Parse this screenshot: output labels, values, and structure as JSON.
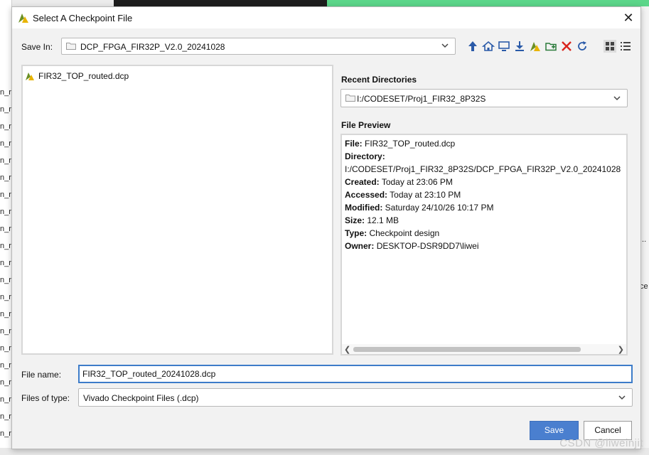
{
  "dialog": {
    "title": "Select A Checkpoint File",
    "close_glyph": "✕"
  },
  "save_in": {
    "label": "Save In:",
    "value": "DCP_FPGA_FIR32P_V2.0_20241028"
  },
  "toolbar": {
    "icons": [
      "up-one-level-icon",
      "home-icon",
      "desktop-icon",
      "download-icon",
      "vivado-project-icon",
      "new-folder-icon",
      "delete-icon",
      "refresh-icon",
      "details-view-icon",
      "list-view-icon"
    ]
  },
  "files": [
    {
      "name": "FIR32_TOP_routed.dcp"
    }
  ],
  "recent": {
    "title": "Recent Directories",
    "value": "I:/CODESET/Proj1_FIR32_8P32S"
  },
  "preview": {
    "title": "File Preview",
    "file_label": "File:",
    "file_value": "FIR32_TOP_routed.dcp",
    "directory_label": "Directory:",
    "directory_value": "I:/CODESET/Proj1_FIR32_8P32S/DCP_FPGA_FIR32P_V2.0_20241028",
    "created_label": "Created:",
    "created_value": "Today at 23:06 PM",
    "accessed_label": "Accessed:",
    "accessed_value": "Today at 23:10 PM",
    "modified_label": "Modified:",
    "modified_value": "Saturday 24/10/26 10:17 PM",
    "size_label": "Size:",
    "size_value": "12.1 MB",
    "type_label": "Type:",
    "type_value": "Checkpoint design",
    "owner_label": "Owner:",
    "owner_value": "DESKTOP-DSR9DD7\\liwei"
  },
  "file_name": {
    "label": "File name:",
    "value": "FIR32_TOP_routed_20241028.dcp"
  },
  "file_type": {
    "label": "Files of type:",
    "value": "Vivado Checkpoint Files (.dcp)"
  },
  "buttons": {
    "save": "Save",
    "cancel": "Cancel"
  },
  "background": {
    "left_rows": [
      "n_r",
      "n_r",
      "n_r",
      "n_r",
      "n_r",
      "n_r",
      "n_r",
      "n_r",
      "n_r",
      "n_r",
      "n_r",
      "n_r",
      "n_r",
      "n_r",
      "n_r",
      "n_r",
      "n_r",
      "n_r",
      "n_r",
      "n_r",
      "n_r"
    ],
    "right_texts": [
      "...",
      "ce"
    ]
  },
  "watermark": "CSDN @liweinjit",
  "colors": {
    "accent": "#4a7fcf",
    "vivado_green": "#6b8f23",
    "vivado_yellow": "#e8b400"
  }
}
